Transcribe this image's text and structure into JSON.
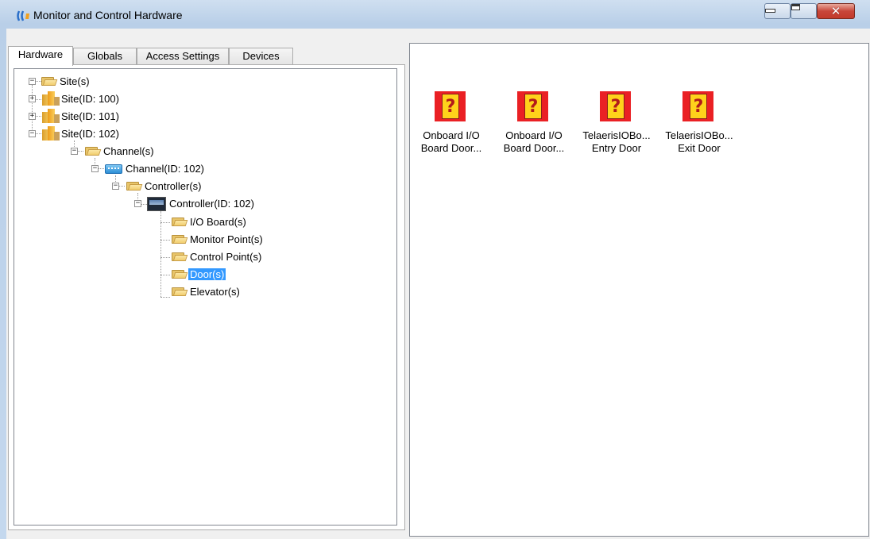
{
  "window": {
    "title": "Monitor and Control Hardware",
    "controls": {
      "minimize": "minimize",
      "maximize": "maximize",
      "close": "✕"
    }
  },
  "tabs": [
    {
      "label": "Hardware",
      "active": true
    },
    {
      "label": "Globals",
      "active": false
    },
    {
      "label": "Access Settings",
      "active": false
    },
    {
      "label": "Devices",
      "active": false
    }
  ],
  "tree": {
    "root": {
      "label": "Site(s)",
      "expander": "−"
    },
    "sites": [
      {
        "label": "Site(ID: 100)",
        "expander": "+"
      },
      {
        "label": "Site(ID: 101)",
        "expander": "+"
      },
      {
        "label": "Site(ID: 102)",
        "expander": "−"
      }
    ],
    "channels_folder": {
      "label": "Channel(s)",
      "expander": "−"
    },
    "channel": {
      "label": "Channel(ID: 102)",
      "expander": "−"
    },
    "controllers_folder": {
      "label": "Controller(s)",
      "expander": "−"
    },
    "controller": {
      "label": "Controller(ID: 102)",
      "expander": "−"
    },
    "controller_children": [
      {
        "label": "I/O Board(s)",
        "selected": false
      },
      {
        "label": "Monitor Point(s)",
        "selected": false
      },
      {
        "label": "Control Point(s)",
        "selected": false
      },
      {
        "label": "Door(s)",
        "selected": true
      },
      {
        "label": "Elevator(s)",
        "selected": false
      }
    ]
  },
  "doors": [
    {
      "line1": "Onboard I/O",
      "line2": "Board Door...",
      "icon": "unknown-door-icon"
    },
    {
      "line1": "Onboard I/O",
      "line2": "Board Door...",
      "icon": "unknown-door-icon"
    },
    {
      "line1": "TelaerisIOBo...",
      "line2": "Entry Door",
      "icon": "unknown-door-icon"
    },
    {
      "line1": "TelaerisIOBo...",
      "line2": "Exit Door",
      "icon": "unknown-door-icon"
    }
  ],
  "colors": {
    "selection": "#3399ff",
    "door_icon_bg": "#ea2024",
    "door_icon_card": "#ffd21b"
  }
}
